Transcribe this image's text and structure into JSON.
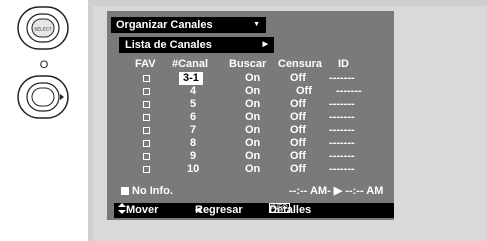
{
  "remote": {
    "top_button_label": "SELECT",
    "or_label": "O"
  },
  "menu": {
    "title": "Organizar Canales",
    "title_arrow": "▼",
    "submenu": "Lista de Canales",
    "submenu_arrow": "▶"
  },
  "table": {
    "columns": [
      "FAV",
      "#Canal",
      "Buscar",
      "Censura",
      "ID"
    ],
    "rows": [
      {
        "channel": "3-1",
        "buscar": "On",
        "censura": "Off",
        "id": "-------"
      },
      {
        "channel": "4",
        "buscar": "On",
        "censura": "Off",
        "id": "-------"
      },
      {
        "channel": "5",
        "buscar": "On",
        "censura": "Off",
        "id": "-------"
      },
      {
        "channel": "6",
        "buscar": "On",
        "censura": "Off",
        "id": "-------"
      },
      {
        "channel": "7",
        "buscar": "On",
        "censura": "Off",
        "id": "-------"
      },
      {
        "channel": "8",
        "buscar": "On",
        "censura": "Off",
        "id": "-------"
      },
      {
        "channel": "9",
        "buscar": "On",
        "censura": "Off",
        "id": "-------"
      },
      {
        "channel": "10",
        "buscar": "On",
        "censura": "Off",
        "id": "-------"
      }
    ]
  },
  "status": {
    "no_info": "No Info.",
    "time_range": "--:-- AM-  ▶ --:-- AM"
  },
  "footer": {
    "move_label": "Mover",
    "back_arrow": "◀",
    "back_label": "Regresar",
    "info_key": "INFO",
    "details_label": "Detalles"
  }
}
